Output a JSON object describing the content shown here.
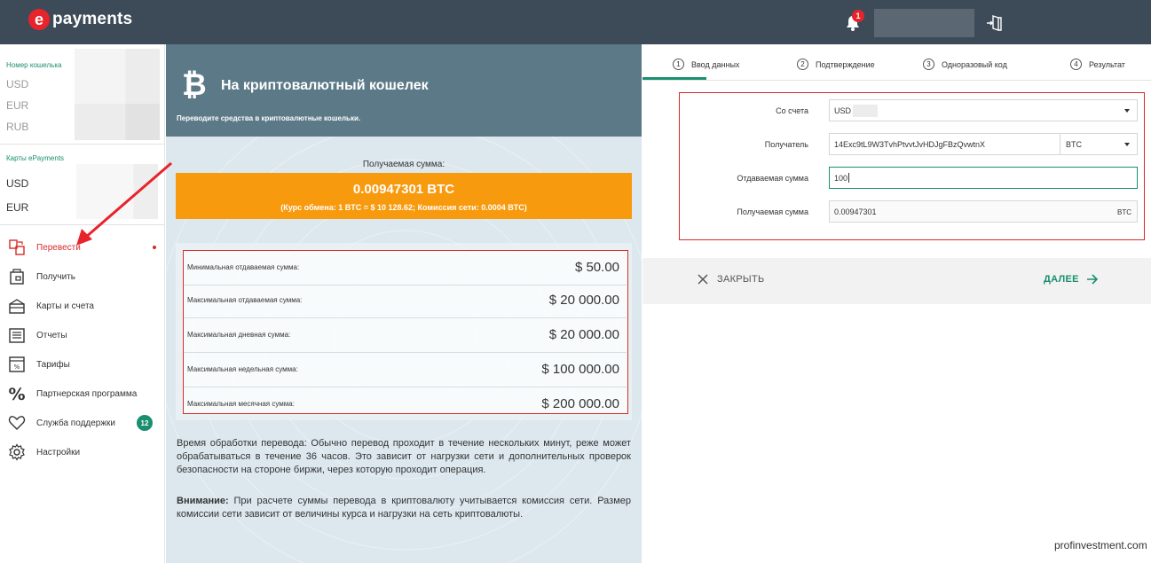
{
  "header": {
    "logo_mark": "e",
    "logo_text": "payments",
    "notifications_count": "1"
  },
  "sidebar": {
    "wallet_title": "Номер кошелька",
    "wallet_currencies": [
      "USD",
      "EUR",
      "RUB"
    ],
    "cards_title": "Карты ePayments",
    "card_currencies": [
      "USD",
      "EUR"
    ],
    "items": [
      {
        "label": "Перевести",
        "icon": "transfer-icon",
        "active": true
      },
      {
        "label": "Получить",
        "icon": "receive-icon"
      },
      {
        "label": "Карты и счета",
        "icon": "wallet-icon"
      },
      {
        "label": "Отчеты",
        "icon": "reports-icon"
      },
      {
        "label": "Тарифы",
        "icon": "tariffs-icon"
      },
      {
        "label": "Партнерская программа",
        "icon": "percent-icon"
      },
      {
        "label": "Служба поддержки",
        "icon": "heart-icon",
        "badge": "12"
      },
      {
        "label": "Настройки",
        "icon": "gear-icon"
      }
    ]
  },
  "info": {
    "logo": "₿",
    "title": "На криптовалютный кошелек",
    "subtitle": "Переводите средства в криптовалютные кошельки.",
    "received_label": "Получаемая сумма:",
    "received_amount": "0.00947301 BTC",
    "rate_line": "(Курс обмена: 1 BTC = $ 10 128.62; Комиссия сети: 0.0004 BTC)",
    "limits": [
      {
        "label": "Минимальная отдаваемая сумма:",
        "value": "$ 50.00"
      },
      {
        "label": "Максимальная отдаваемая сумма:",
        "value": "$ 20 000.00"
      },
      {
        "label": "Максимальная дневная сумма:",
        "value": "$ 20 000.00"
      },
      {
        "label": "Максимальная недельная сумма:",
        "value": "$ 100 000.00"
      },
      {
        "label": "Максимальная месячная сумма:",
        "value": "$ 200 000.00"
      }
    ],
    "processing_text": "Время обработки перевода: Обычно перевод проходит в течение нескольких минут, реже может обрабатываться в течение 36 часов. Это зависит от нагрузки сети и дополнительных проверок безопасности на стороне биржи, через которую проходит операция.",
    "warning_label": "Внимание:",
    "warning_text": " При расчете суммы перевода в криптовалюту учитывается комиссия сети. Размер комиссии сети зависит от величины курса и нагрузки на сеть криптовалюты."
  },
  "steps": [
    {
      "num": "1",
      "label": "Ввод данных"
    },
    {
      "num": "2",
      "label": "Подтверждение"
    },
    {
      "num": "3",
      "label": "Одноразовый код"
    },
    {
      "num": "4",
      "label": "Результат"
    }
  ],
  "form": {
    "from_label": "Со счета",
    "from_value": "USD",
    "recipient_label": "Получатель",
    "recipient_value": "14Exc9tL9W3TvhPtvvtJvHDJgFBzQvwtnX",
    "recipient_currency": "BTC",
    "send_label": "Отдаваемая сумма",
    "send_value": "100",
    "receive_label": "Получаемая сумма",
    "receive_value": "0.00947301",
    "receive_currency": "BTC"
  },
  "actions": {
    "close_label": "ЗАКРЫТЬ",
    "next_label": "ДАЛЕЕ"
  },
  "watermark": "profinvestment.com",
  "colors": {
    "header_bg": "#3d4b59",
    "accent_green": "#1a8f6f",
    "highlight_red": "#d92b2b",
    "orange": "#f89a0e",
    "info_header": "#5c7988"
  }
}
